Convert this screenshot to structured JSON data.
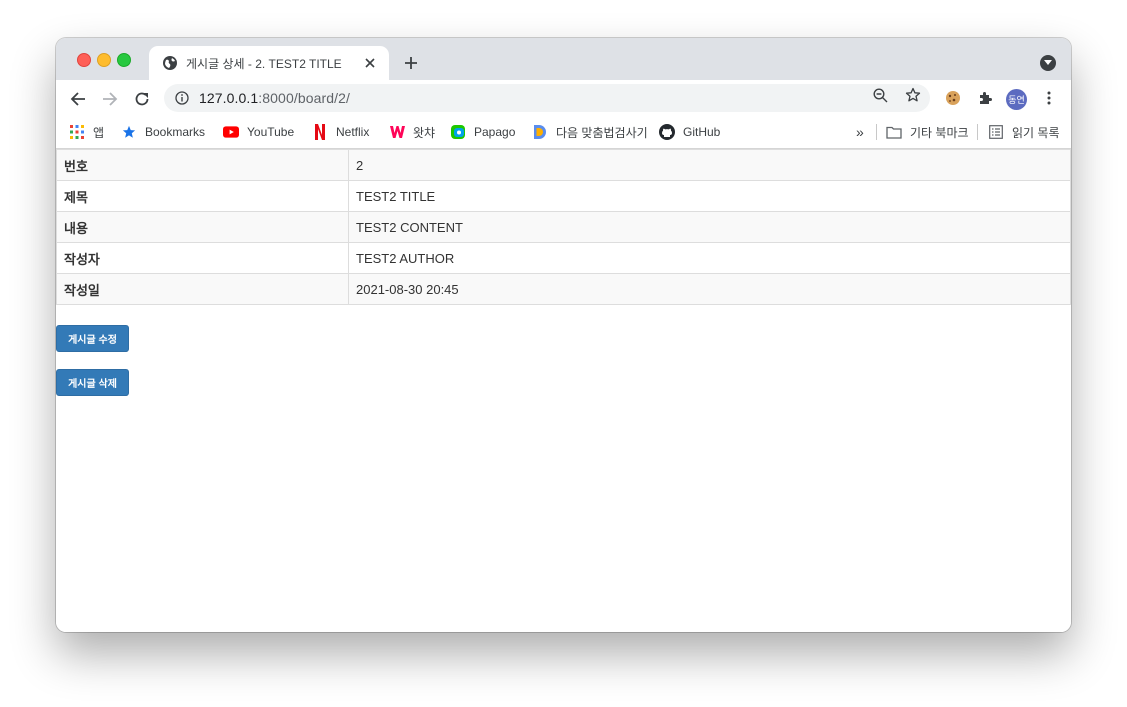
{
  "browser": {
    "tab_title": "게시글 상세 - 2. TEST2 TITLE",
    "url_host": "127.0.0.1",
    "url_path": ":8000/board/2/",
    "profile_initials": "동연"
  },
  "bookmarks": {
    "apps": "앱",
    "items": [
      "Bookmarks",
      "YouTube",
      "Netflix",
      "왓챠",
      "Papago",
      "다음 맞춤법검사기",
      "GitHub"
    ],
    "overflow": "»",
    "other": "기타 북마크",
    "reading_list": "읽기 목록"
  },
  "post": {
    "rows": [
      {
        "label": "번호",
        "value": "2"
      },
      {
        "label": "제목",
        "value": "TEST2 TITLE"
      },
      {
        "label": "내용",
        "value": "TEST2 CONTENT"
      },
      {
        "label": "작성자",
        "value": "TEST2 AUTHOR"
      },
      {
        "label": "작성일",
        "value": "2021-08-30 20:45"
      }
    ]
  },
  "actions": {
    "edit_label": "게시글 수정",
    "delete_label": "게시글 삭제"
  },
  "colors": {
    "button": "#337ab7",
    "titlebar": "#dee1e6",
    "table_stripe": "#f9f9f9"
  }
}
